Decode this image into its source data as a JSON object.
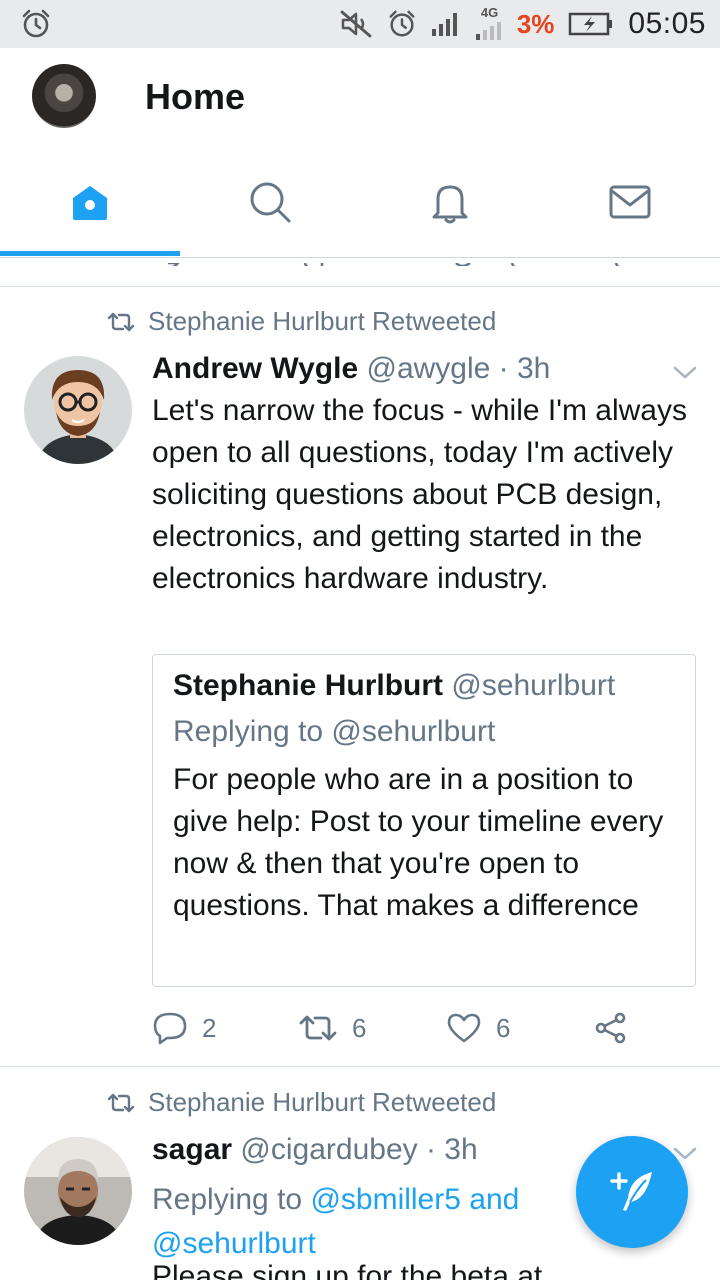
{
  "status_bar": {
    "network_label": "4G",
    "battery_percent": "3%",
    "time": "05:05"
  },
  "header": {
    "title": "Home"
  },
  "tabs": [
    {
      "name": "home",
      "icon": "home-icon",
      "active": true
    },
    {
      "name": "search",
      "icon": "search-icon",
      "active": false
    },
    {
      "name": "notifications",
      "icon": "bell-icon",
      "active": false
    },
    {
      "name": "messages",
      "icon": "mail-icon",
      "active": false
    }
  ],
  "colors": {
    "accent": "#1da1f2",
    "secondary_text": "#657786",
    "battery_low": "#e8431f"
  },
  "tweets": [
    {
      "retweeted_by": "Stephanie Hurlburt Retweeted",
      "name": "Andrew Wygle",
      "handle_time": "@awygle · 3h",
      "text": "Let's narrow the focus - while I'm always open to all questions, today I'm actively soliciting questions about PCB design, electronics, and getting started in the electronics hardware industry.",
      "quote": {
        "name": "Stephanie Hurlburt",
        "handle": "@sehurlburt",
        "replying_to": "Replying to @sehurlburt",
        "text": "For people who are in a position to give help: Post to your timeline every now & then that you're open to questions. That makes a difference"
      },
      "replies": "2",
      "retweets": "6",
      "likes": "6"
    },
    {
      "retweeted_by": "Stephanie Hurlburt Retweeted",
      "name": "sagar",
      "handle_time": "@cigardubey · 3h",
      "replying_prefix": "Replying to ",
      "mention_1": "@sbmiller5",
      "mention_join": " and ",
      "mention_2": "@sehurlburt",
      "text_cut": "Please sign up for the beta at"
    }
  ]
}
